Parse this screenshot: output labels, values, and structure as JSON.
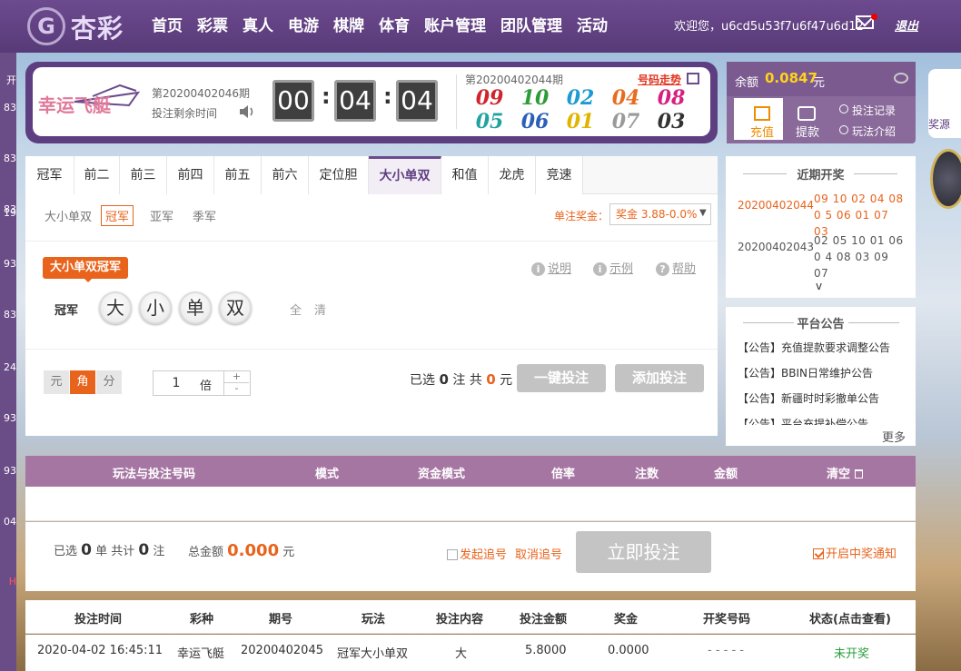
{
  "brand": {
    "logo_mark": "G",
    "name": "杏彩"
  },
  "nav": [
    "首页",
    "彩票",
    "真人",
    "电游",
    "棋牌",
    "体育",
    "账户管理",
    "团队管理",
    "活动"
  ],
  "user": {
    "welcome": "欢迎您，u6cd5u53f7u6f47u6d12",
    "logout": "退出"
  },
  "left_numbers": [
    "开",
    "83",
    "83",
    "83",
    "19",
    "93",
    "83",
    "24",
    "93",
    "93",
    "04",
    "H"
  ],
  "lottery": {
    "name": "幸运飞艇",
    "period": "第20200402046期",
    "remain_label": "投注剩余时间",
    "timer": [
      "00",
      "04",
      "04"
    ],
    "last_period": "第20200402044期",
    "trend_link": "号码走势",
    "balls": [
      {
        "n": "09",
        "color": "#d0232b"
      },
      {
        "n": "10",
        "color": "#2e9b3a"
      },
      {
        "n": "02",
        "color": "#1b9bd1"
      },
      {
        "n": "04",
        "color": "#e86b1f"
      },
      {
        "n": "08",
        "color": "#d6207f"
      },
      {
        "n": "05",
        "color": "#20a3a0"
      },
      {
        "n": "06",
        "color": "#2c5fb8"
      },
      {
        "n": "01",
        "color": "#e0b400"
      },
      {
        "n": "07",
        "color": "#9a9a9a"
      },
      {
        "n": "03",
        "color": "#333333"
      }
    ]
  },
  "balance": {
    "label": "余额",
    "value": "0.0847",
    "unit": "元",
    "recharge": "充值",
    "withdraw": "提款",
    "bet_record": "投注记录",
    "rules": "玩法介绍",
    "side_ad": "奖源"
  },
  "tabs": [
    "冠军",
    "前二",
    "前三",
    "前四",
    "前五",
    "前六",
    "定位胆",
    "大小单双",
    "和值",
    "龙虎",
    "竞速"
  ],
  "subtabs": [
    "大小单双",
    "冠军",
    "亚军",
    "季军"
  ],
  "odds": {
    "label": "单注奖金：",
    "value": "奖金 3.88-0.0%",
    "arrow": "▼"
  },
  "play": {
    "tag": "大小单双冠军",
    "help_links": [
      "说明",
      "示例",
      "帮助"
    ],
    "help_icons": [
      "i",
      "i",
      "?"
    ],
    "row_label": "冠军",
    "options": [
      "大",
      "小",
      "单",
      "双"
    ],
    "quick": [
      "全",
      "清"
    ]
  },
  "units": [
    "元",
    "角",
    "分"
  ],
  "multiplier": {
    "value": "1",
    "unit": "倍",
    "up": "+",
    "down": "-"
  },
  "selection": {
    "pre": "已选",
    "count": "0",
    "mid": "注  共",
    "amount": "0",
    "post": "元"
  },
  "buttons": {
    "one_click": "一键投注",
    "add": "添加投注",
    "bet_now": "立即投注"
  },
  "recent": {
    "title": "近期开奖",
    "rows": [
      {
        "period": "20200402044",
        "nums": "09 10 02 04 08 0 5 06 01 07 03"
      },
      {
        "period": "20200402043",
        "nums": "02 05 10 01 06 0 4 08 03 09 07"
      }
    ],
    "more": "v"
  },
  "notice": {
    "title": "平台公告",
    "items": [
      "【公告】充值提款要求调整公告",
      "【公告】BBIN日常维护公告",
      "【公告】新疆时时彩撤单公告",
      "【公告】平台充提补偿公告"
    ],
    "more": "更多"
  },
  "bet_table": {
    "headers": [
      "玩法与投注号码",
      "模式",
      "资金模式",
      "倍率",
      "注数",
      "金额",
      "清空"
    ],
    "footer": {
      "sel_pre": "已选",
      "sel_count": "0",
      "sel_mid": "单 共计",
      "sel_notes": "0",
      "sel_post": "注",
      "total_label": "总金额",
      "total_value": "0.000",
      "total_unit": "元",
      "chase": "发起追号",
      "cancel_chase": "取消追号",
      "notify": "开启中奖通知"
    }
  },
  "records": {
    "headers": [
      "投注时间",
      "彩种",
      "期号",
      "玩法",
      "投注内容",
      "投注金额",
      "奖金",
      "开奖号码",
      "状态(点击查看)"
    ],
    "rows": [
      [
        "2020-04-02 16:45:11",
        "幸运飞艇",
        "20200402045",
        "冠军大小单双",
        "大",
        "5.8000",
        "0.0000",
        "- - - - -",
        "未开奖"
      ]
    ]
  }
}
